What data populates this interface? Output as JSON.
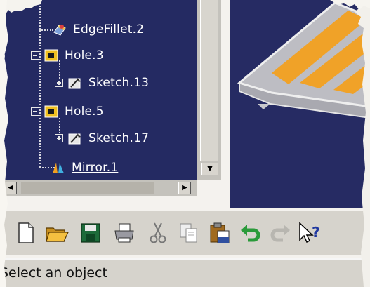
{
  "tree": {
    "items": [
      {
        "label": "EdgeFillet.2",
        "icon": "edge-fillet-icon"
      },
      {
        "label": "Hole.3",
        "icon": "hole-icon"
      },
      {
        "label": "Sketch.13",
        "icon": "sketch-icon"
      },
      {
        "label": "Hole.5",
        "icon": "hole-icon"
      },
      {
        "label": "Sketch.17",
        "icon": "sketch-icon"
      },
      {
        "label": "Mirror.1",
        "icon": "mirror-icon"
      }
    ]
  },
  "toolbar": {
    "buttons": [
      "new-icon",
      "open-icon",
      "save-icon",
      "print-icon",
      "cut-icon",
      "copy-icon",
      "paste-icon",
      "undo-icon",
      "redo-icon",
      "whats-this-icon"
    ]
  },
  "status": {
    "text": "Select an object"
  },
  "colors": {
    "tree_bg": "#242a62",
    "viewport_bg": "#262b63",
    "model_orange": "#f0a228",
    "chrome": "#d6d3cc"
  }
}
